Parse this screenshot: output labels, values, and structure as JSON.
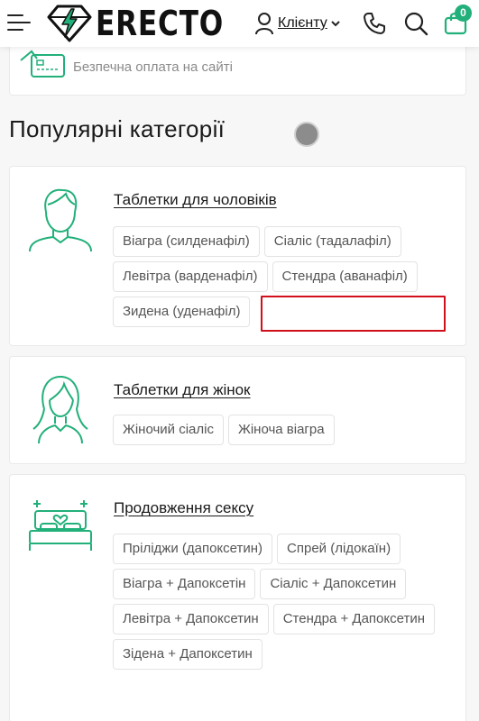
{
  "header": {
    "logo_text": "ERECTO",
    "account_label": "Клієнту",
    "cart_count": "0"
  },
  "payment": {
    "text": "Безпечна оплата на сайті"
  },
  "popular": {
    "title": "Популярні категорії",
    "categories": [
      {
        "title": "Таблетки для чоловіків",
        "tags": [
          "Віагра (силденафіл)",
          "Сіаліс (тадалафіл)",
          "Левітра (варденафіл)",
          "Стендра (аванафіл)",
          "Зидена (уденафіл)"
        ]
      },
      {
        "title": "Таблетки для жінок",
        "tags": [
          "Жіночий сіаліс",
          "Жіноча віагра"
        ]
      },
      {
        "title": "Продовження сексу",
        "tags": [
          "Пріліджи (дапоксетин)",
          "Спрей (лідокаїн)",
          "Віагра + Дапоксетін",
          "Сіаліс + Дапоксетин",
          "Левітра + Дапоксетин",
          "Стендра + Дапоксетин",
          "Зідена + Дапоксетин"
        ]
      }
    ]
  },
  "colors": {
    "accent": "#22b07a",
    "highlight": "#d10f1b"
  }
}
